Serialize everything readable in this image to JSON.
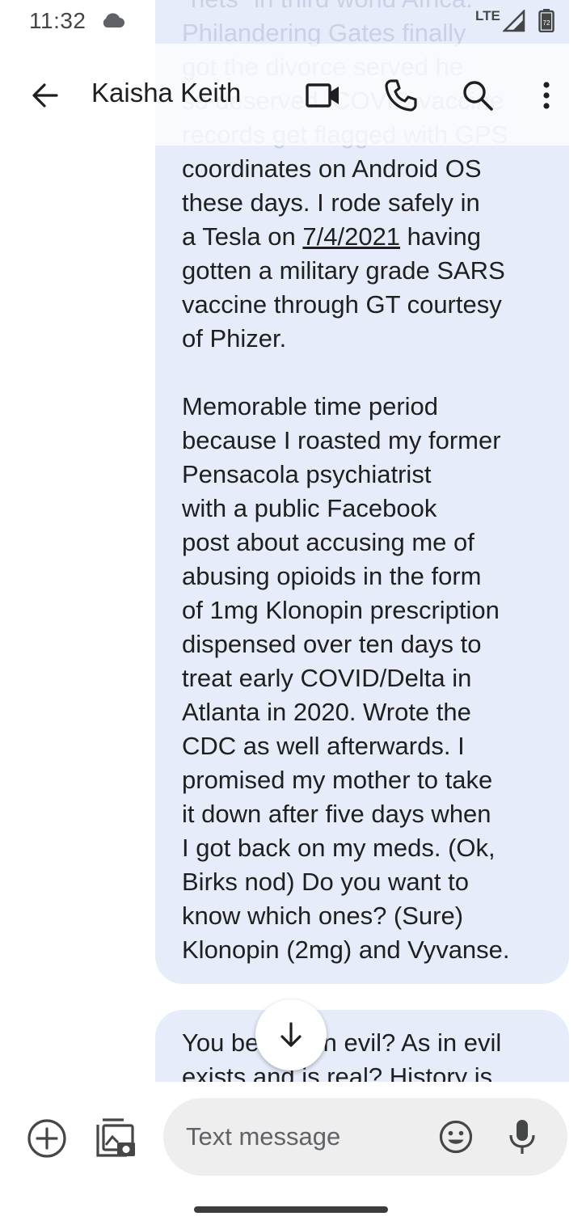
{
  "status_bar": {
    "time": "11:32",
    "network": "LTE",
    "battery": "72"
  },
  "app_bar": {
    "contact_name": "Kaisha Keith",
    "icons": [
      "back-arrow-icon",
      "video-call-icon",
      "phone-icon",
      "search-icon",
      "more-vert-icon"
    ]
  },
  "messages": [
    {
      "faded_top": "\"nets\" in third world Africa.\nPhilandering Gates finally\ngot the divorce served he\nso deserved. COVID vaccine\nrecords get flagged with GPS",
      "part_a": "coordinates on Android OS\nthese days. I rode safely in\na Tesla on ",
      "date_link": "7/4/2021",
      "part_b": " having\ngotten a military grade SARS\nvaccine through GT courtesy\nof Phizer.\n\nMemorable time period\nbecause I roasted my former\nPensacola psychiatrist\nwith a public Facebook\npost about accusing me of\nabusing opioids in the form\nof 1mg Klonopin prescription\ndispensed over ten days to\ntreat early COVID/Delta in\nAtlanta in 2020. Wrote the\nCDC as well afterwards. I\npromised my mother to take\nit down after five days when\nI got back on my meds. (Ok,\nBirks nod) Do you want to\nknow which ones? (Sure)\nKlonopin (2mg) and Vyvanse."
    },
    {
      "text": "You believe in evil? As in evil\nexists and is real? History is"
    }
  ],
  "compose": {
    "placeholder": "Text message",
    "value": ""
  },
  "colors": {
    "bubble": "#e6ecfa",
    "text": "#1f1f1f",
    "field": "#eeeeee"
  }
}
